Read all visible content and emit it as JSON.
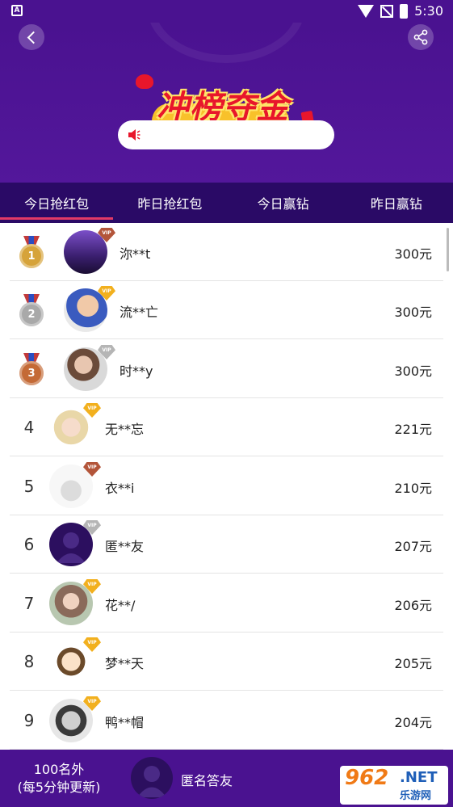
{
  "status_bar": {
    "time": "5:30"
  },
  "header": {
    "logo_text": "冲榜夺金",
    "notice_text": ""
  },
  "tabs": [
    {
      "label": "今日抢红包",
      "active": true
    },
    {
      "label": "昨日抢红包",
      "active": false
    },
    {
      "label": "今日赢钻",
      "active": false
    },
    {
      "label": "昨日赢钻",
      "active": false
    }
  ],
  "rows": [
    {
      "rank": "1",
      "medal": "gold",
      "name": "沵**t",
      "amount": "300元",
      "vip": "bronze"
    },
    {
      "rank": "2",
      "medal": "silver",
      "name": "流**亡",
      "amount": "300元",
      "vip": "gold"
    },
    {
      "rank": "3",
      "medal": "bronze",
      "name": "时**y",
      "amount": "300元",
      "vip": "silver"
    },
    {
      "rank": "4",
      "name": "无**忘",
      "amount": "221元",
      "vip": "gold"
    },
    {
      "rank": "5",
      "name": "衣**i",
      "amount": "210元",
      "vip": "bronze"
    },
    {
      "rank": "6",
      "name": "匿**友",
      "amount": "207元",
      "vip": "silver"
    },
    {
      "rank": "7",
      "name": "花**/",
      "amount": "206元",
      "vip": "gold"
    },
    {
      "rank": "8",
      "name": "梦**天",
      "amount": "205元",
      "vip": "gold"
    },
    {
      "rank": "9",
      "name": "鸭**帽",
      "amount": "204元",
      "vip": "gold"
    }
  ],
  "footer": {
    "rank_line1": "100名外",
    "rank_line2": "(每5分钟更新)",
    "name": "匿名答友"
  },
  "watermark": {
    "number": "962",
    "net": ".NET",
    "site": "乐游网"
  },
  "colors": {
    "primary": "#4a1290",
    "tab_bg": "#2a0a66",
    "tab_indicator": "#e33a66"
  }
}
